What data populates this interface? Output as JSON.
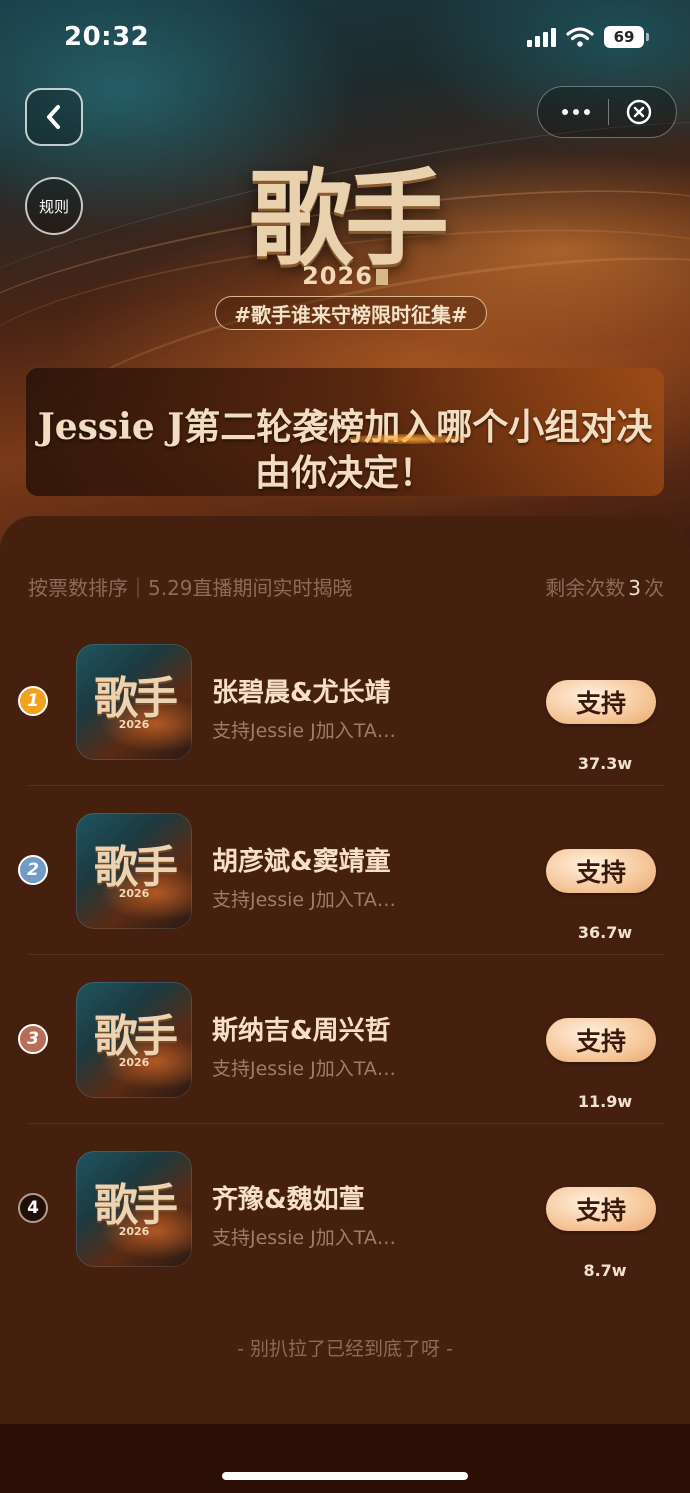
{
  "status_bar": {
    "time": "20:32",
    "battery": "69"
  },
  "nav": {
    "back_icon": "chevron-left-icon",
    "rule_label": "规则",
    "more_icon": "more-dots-icon",
    "close_icon": "close-circle-icon"
  },
  "hero": {
    "logo_title": "歌手",
    "logo_year": "2026",
    "hashtag": "#歌手谁来守榜限时征集#",
    "banner_line1": "Jessie J第二轮袭榜加入哪个小组对决",
    "banner_line2": "由你决定！"
  },
  "list_header": {
    "sort_text": "按票数排序｜5.29直播期间实时揭晓",
    "remain_prefix": "剩余次数",
    "remain_count": "3",
    "remain_suffix": "次"
  },
  "items": [
    {
      "rank": "1",
      "thumb_title": "歌手",
      "thumb_year": "2026",
      "name": "张碧晨&尤长靖",
      "desc": "支持Jessie J加入TA…",
      "button": "支持",
      "votes": "37.3w"
    },
    {
      "rank": "2",
      "thumb_title": "歌手",
      "thumb_year": "2026",
      "name": "胡彦斌&窦靖童",
      "desc": "支持Jessie J加入TA…",
      "button": "支持",
      "votes": "36.7w"
    },
    {
      "rank": "3",
      "thumb_title": "歌手",
      "thumb_year": "2026",
      "name": "斯纳吉&周兴哲",
      "desc": "支持Jessie J加入TA…",
      "button": "支持",
      "votes": "11.9w"
    },
    {
      "rank": "4",
      "thumb_title": "歌手",
      "thumb_year": "2026",
      "name": "齐豫&魏如萱",
      "desc": "支持Jessie J加入TA…",
      "button": "支持",
      "votes": "8.7w"
    }
  ],
  "footer_text": "- 别扒拉了已经到底了呀 -"
}
